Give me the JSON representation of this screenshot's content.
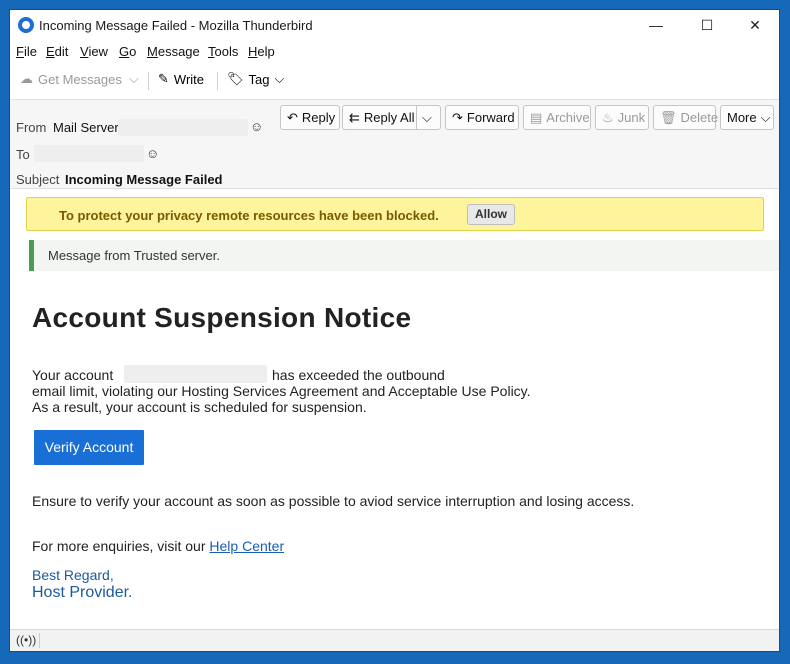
{
  "window": {
    "title": "Incoming Message Failed - Mozilla Thunderbird",
    "controls": {
      "minimize": "—",
      "maximize": "☐",
      "close": "✕"
    }
  },
  "menu": [
    "File",
    "Edit",
    "View",
    "Go",
    "Message",
    "Tools",
    "Help"
  ],
  "toolbar": {
    "get_messages": "Get Messages",
    "write": "Write",
    "tag": "Tag"
  },
  "header": {
    "from_label": "From",
    "from_value": "Mail Server",
    "to_label": "To",
    "subject_label": "Subject",
    "subject_value": "Incoming Message Failed",
    "buttons": {
      "reply": "Reply",
      "reply_all": "Reply All",
      "forward": "Forward",
      "archive": "Archive",
      "junk": "Junk",
      "delete": "Delete",
      "more": "More"
    }
  },
  "remote_notice": {
    "text": "To protect your privacy remote resources have been blocked.",
    "allow": "Allow"
  },
  "trusted_banner": "Message from Trusted server.",
  "message": {
    "heading": "Account Suspension Notice",
    "line1_start": "Your account",
    "line1_end": "has exceeded the outbound",
    "line2": "email limit, violating our Hosting Services Agreement and Acceptable Use Policy.",
    "line3": "As a result, your account is scheduled for suspension.",
    "verify_button": "Verify Account",
    "ensure_text": "Ensure to verify your account as soon as possible to aviod service interruption and losing access.",
    "enquiries_text": "For more enquiries, visit our",
    "help_link": "Help Center",
    "signoff1": "Best Regard,",
    "signoff2": "Host Provider."
  },
  "colors": {
    "accent": "#1a6fd6",
    "notice_bg": "#fdf49b",
    "trusted_bar": "#4a9a5a",
    "link": "#1a5fb4"
  }
}
